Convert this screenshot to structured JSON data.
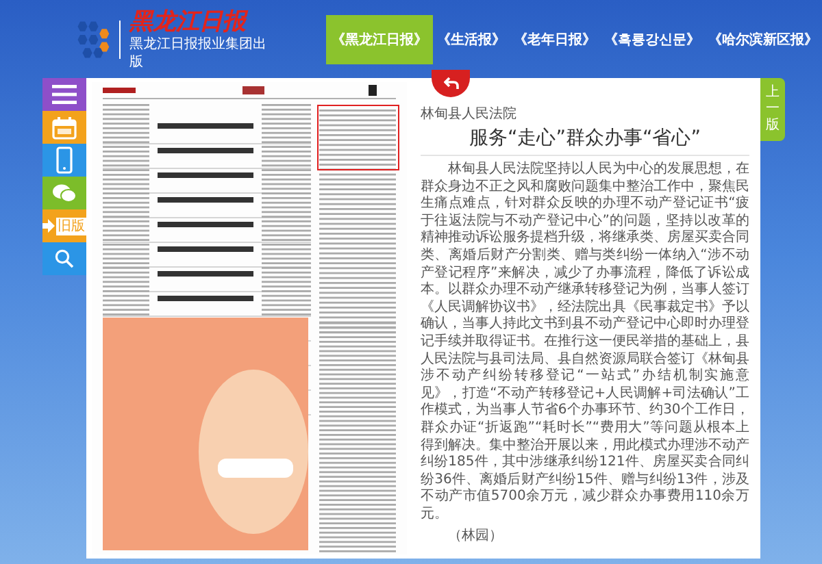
{
  "header": {
    "logo_title": "黑龙江日报",
    "logo_subtitle": "黑龙江日报报业集团出版"
  },
  "tabs": [
    {
      "label": "《黑龙江日报》",
      "selected": true
    },
    {
      "label": "《生活报》",
      "selected": false
    },
    {
      "label": "《老年日报》",
      "selected": false
    },
    {
      "label": "《흑룡강신문》",
      "selected": false
    },
    {
      "label": "《哈尔滨新区报》",
      "selected": false
    }
  ],
  "sidebar": {
    "items": [
      {
        "kind": "menu"
      },
      {
        "kind": "calendar"
      },
      {
        "kind": "phone"
      },
      {
        "kind": "chat"
      },
      {
        "kind": "old",
        "label": "旧版"
      },
      {
        "kind": "search"
      }
    ]
  },
  "article": {
    "source": "林甸县人民法院",
    "title": "服务“走心”群众办事“省心”",
    "body": "林甸县人民法院坚持以人民为中心的发展思想，在群众身边不正之风和腐败问题集中整治工作中，聚焦民生痛点难点，针对群众反映的办理不动产登记证书“疲于往返法院与不动产登记中心”的问题，坚持以改革的精神推动诉讼服务提档升级，将继承类、房屋买卖合同类、离婚后财产分割类、赠与类纠纷一体纳入“涉不动产登记程序”来解决，减少了办事流程，降低了诉讼成本。以群众办理不动产继承转移登记为例，当事人签订《人民调解协议书》，经法院出具《民事裁定书》予以确认，当事人持此文书到县不动产登记中心即时办理登记手续并取得证书。在推行这一便民举措的基础上，县人民法院与县司法局、县自然资源局联合签订《林甸县涉不动产纠纷转移登记“一站式”办结机制实施意见》，打造“不动产转移登记+人民调解+司法确认”工作模式，为当事人节省6个办事环节、约30个工作日，群众办证“折返跑”“耗时长”“费用大”等问题从根本上得到解决。集中整治开展以来，用此模式办理涉不动产纠纷185件，其中涉继承纠纷121件、房屋买卖合同纠纷36件、离婚后财产纠纷15件、赠与纠纷13件，涉及不动产市值5700余万元，减少群众办事费用110余万元。",
    "signature": "（林园）"
  },
  "prev_page": {
    "label": "上一版"
  }
}
